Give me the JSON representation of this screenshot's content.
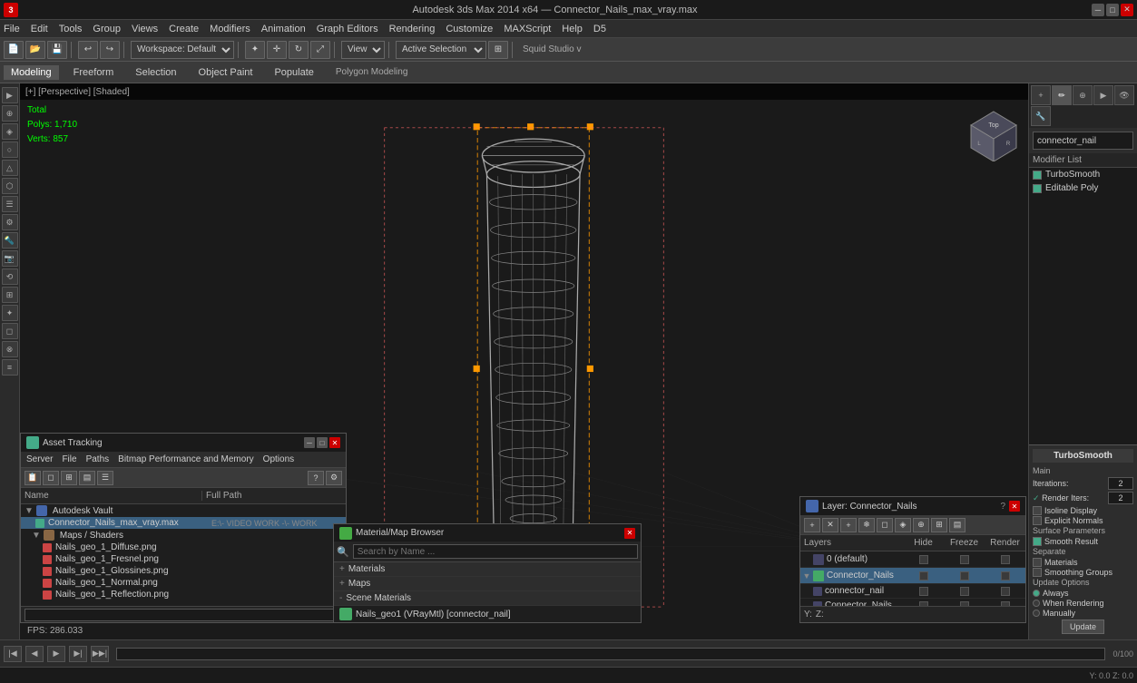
{
  "titlebar": {
    "title": "Autodesk 3ds Max 2014 x64 — Connector_Nails_max_vray.max",
    "min_label": "─",
    "max_label": "□",
    "close_label": "✕"
  },
  "menubar": {
    "items": [
      "File",
      "Edit",
      "Tools",
      "Group",
      "Views",
      "Create",
      "Modifiers",
      "Animation",
      "Graph Editors",
      "Rendering",
      "Customize",
      "MAXScript",
      "Help",
      "D5"
    ]
  },
  "subtoolbar": {
    "tabs": [
      "Modeling",
      "Freeform",
      "Selection",
      "Object Paint",
      "Populate"
    ]
  },
  "breadcrumb": "Polygon Modeling",
  "viewport": {
    "label": "[+] [Perspective] [Shaded]",
    "stats": {
      "total_label": "Total",
      "polys_label": "Polys:",
      "polys_value": "1,710",
      "verts_label": "Verts:",
      "verts_value": "857"
    },
    "fps_label": "FPS:",
    "fps_value": "286.033"
  },
  "right_panel": {
    "object_name": "connector_nail",
    "modifier_list_label": "Modifier List",
    "modifiers": [
      {
        "name": "TurboSmooth",
        "checked": true
      },
      {
        "name": "Editable Poly",
        "checked": true
      }
    ],
    "turbosmooth": {
      "title": "TurboSmooth",
      "main_label": "Main",
      "iterations_label": "Iterations:",
      "iterations_value": "2",
      "render_iters_label": "Render Iters:",
      "render_iters_value": "2",
      "render_iters_checked": true,
      "isoline_display_label": "Isoline Display",
      "isoline_display_checked": false,
      "explicit_normals_label": "Explicit Normals",
      "explicit_normals_checked": false,
      "surface_params_label": "Surface Parameters",
      "smooth_result_label": "Smooth Result",
      "smooth_result_checked": true,
      "separate_label": "Separate",
      "materials_label": "Materials",
      "materials_checked": false,
      "smoothing_groups_label": "Smoothing Groups",
      "smoothing_groups_checked": false,
      "update_options_label": "Update Options",
      "always_label": "Always",
      "always_checked": true,
      "when_rendering_label": "When Rendering",
      "when_rendering_checked": false,
      "manually_label": "Manually",
      "manually_checked": false,
      "update_btn": "Update"
    }
  },
  "asset_tracking": {
    "title": "Asset Tracking",
    "menus": [
      "Server",
      "File",
      "Paths",
      "Bitmap Performance and Memory",
      "Options"
    ],
    "col_name": "Name",
    "col_path": "Full Path",
    "groups": [
      {
        "name": "Autodesk Vault",
        "files": [
          {
            "name": "Connector_Nails_max_vray.max",
            "path": "E:\\- VIDEO WORK -\\- WORK",
            "selected": true,
            "type": "file"
          },
          {
            "name": "Maps / Shaders",
            "type": "group",
            "files": [
              {
                "name": "Nails_geo_1_Diffuse.png",
                "path": "",
                "type": "image"
              },
              {
                "name": "Nails_geo_1_Fresnel.png",
                "path": "",
                "type": "image"
              },
              {
                "name": "Nails_geo_1_Glossines.png",
                "path": "",
                "type": "image"
              },
              {
                "name": "Nails_geo_1_Normal.png",
                "path": "",
                "type": "image"
              },
              {
                "name": "Nails_geo_1_Reflection.png",
                "path": "",
                "type": "image"
              }
            ]
          }
        ]
      }
    ]
  },
  "mat_browser": {
    "title": "Material/Map Browser",
    "search_placeholder": "Search by Name ...",
    "sections": [
      {
        "name": "+ Materials",
        "expanded": false
      },
      {
        "name": "+ Maps",
        "expanded": false
      },
      {
        "name": "- Scene Materials",
        "expanded": true
      }
    ],
    "scene_material": "Nails_geo1 (VRayMtl) [connector_nail]"
  },
  "layer_window": {
    "title": "Layer: Connector_Nails",
    "help_label": "?",
    "close_label": "✕",
    "col_layers": "Layers",
    "col_hide": "Hide",
    "col_freeze": "Freeze",
    "col_render": "Render",
    "layers": [
      {
        "name": "0 (default)",
        "selected": false,
        "has_children": false
      },
      {
        "name": "Connector_Nails",
        "selected": true,
        "has_children": true,
        "children": [
          {
            "name": "connector_nail"
          },
          {
            "name": "Connector_Nails"
          }
        ]
      }
    ],
    "status_y": "Y:",
    "status_z": "Z:"
  },
  "status_bar": {
    "text": ""
  }
}
